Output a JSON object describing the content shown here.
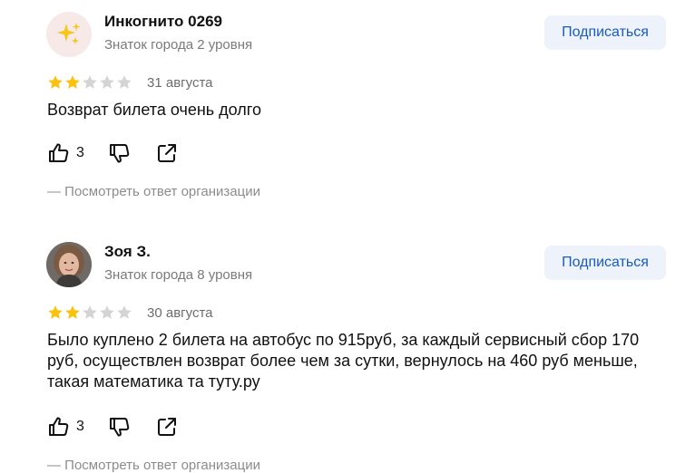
{
  "reviews": [
    {
      "author": "Инкогнито 0269",
      "level": "Знаток города 2 уровня",
      "avatar_icon": "sparkles-icon",
      "subscribe_label": "Подписаться",
      "rating": 2,
      "rating_max": 5,
      "date": "31 августа",
      "text": "Возврат билета очень долго",
      "likes": "3",
      "org_reply_link": "— Посмотреть ответ организации"
    },
    {
      "author": "Зоя З.",
      "level": "Знаток города 8 уровня",
      "avatar_icon": "user-photo",
      "subscribe_label": "Подписаться",
      "rating": 2,
      "rating_max": 5,
      "date": "30 августа",
      "text": "Было куплено 2 билета на автобус по 915руб, за каждый сервисный сбор 170 руб, осуществлен возврат более чем за сутки, вернулось на 460 руб меньше, такая математика та туту.ру",
      "likes": "3",
      "org_reply_link": "— Посмотреть ответ организации"
    }
  ],
  "colors": {
    "star_filled": "#fcc10e",
    "star_empty": "#d4d4d4",
    "subscribe_bg": "#eef3fb",
    "subscribe_text": "#1a5bbf"
  }
}
